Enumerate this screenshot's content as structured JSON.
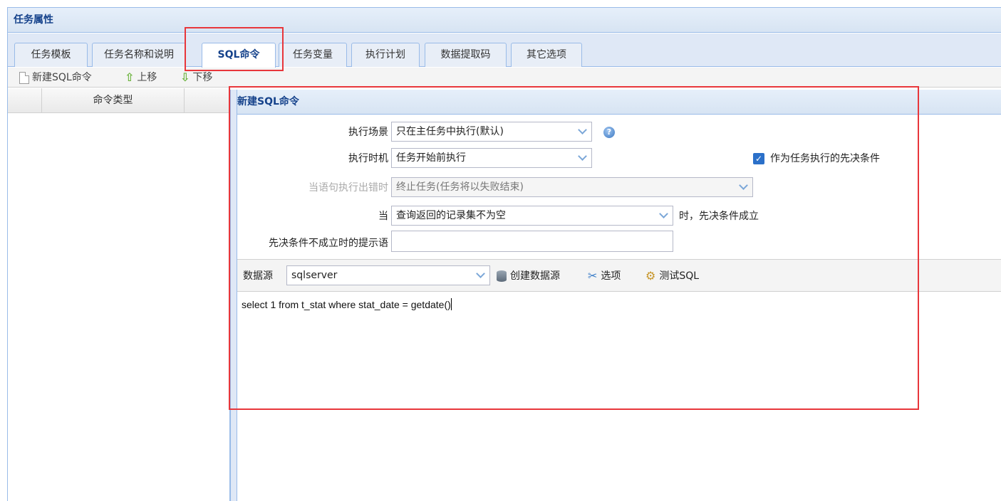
{
  "window": {
    "title": "任务属性"
  },
  "tabs": [
    {
      "label": "任务模板"
    },
    {
      "label": "任务名称和说明"
    },
    {
      "label": "SQL命令"
    },
    {
      "label": "任务变量"
    },
    {
      "label": "执行计划"
    },
    {
      "label": "数据提取码"
    },
    {
      "label": "其它选项"
    }
  ],
  "active_tab": "SQL命令",
  "toolbar": {
    "new_sql": "新建SQL命令",
    "move_up": "上移",
    "move_down": "下移"
  },
  "grid": {
    "col_type": "命令类型"
  },
  "panel": {
    "title": "新建SQL命令",
    "scene_label": "执行场景",
    "scene_value": "只在主任务中执行(默认)",
    "timing_label": "执行时机",
    "timing_value": "任务开始前执行",
    "precondition_label": "作为任务执行的先决条件",
    "precondition_checked": true,
    "onerror_label": "当语句执行出错时",
    "onerror_value": "终止任务(任务将以失败结束)",
    "when_label": "当",
    "when_value": "查询返回的记录集不为空",
    "when_suffix": "时，先决条件成立",
    "prompt_label": "先决条件不成立时的提示语",
    "prompt_value": ""
  },
  "datasource": {
    "label": "数据源",
    "value": "sqlserver",
    "create": "创建数据源",
    "options": "选项",
    "test": "测试SQL"
  },
  "sql": {
    "text": "select 1 from t_stat where stat_date = getdate()"
  },
  "colors": {
    "highlight": "#e8363b",
    "header_text": "#15428b",
    "border": "#99bbe8"
  }
}
